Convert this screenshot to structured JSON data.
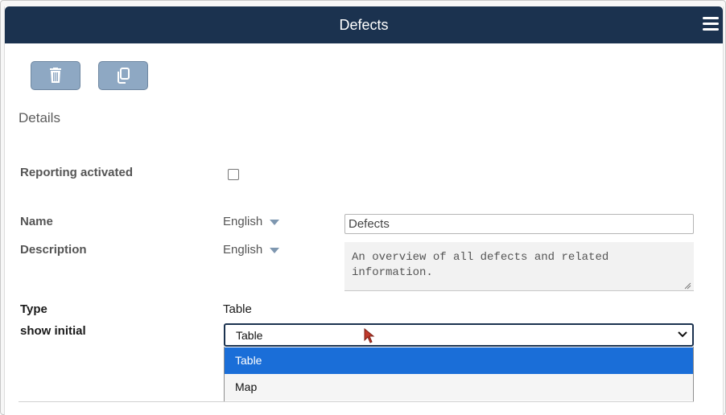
{
  "header": {
    "title": "Defects"
  },
  "toolbar": {
    "delete_icon": "trash-icon",
    "copy_icon": "copy-icon"
  },
  "section": {
    "title": "Details"
  },
  "fields": {
    "reporting_label": "Reporting activated",
    "reporting_checked": false,
    "name_label": "Name",
    "name_language": "English",
    "name_value": "Defects",
    "description_label": "Description",
    "description_language": "English",
    "description_value": "An overview of all defects and related information.",
    "type_label": "Type",
    "type_value": "Table",
    "show_initial_label": "show initial",
    "show_initial_selected": "Table",
    "show_initial_options": [
      "Table",
      "Map"
    ]
  },
  "colors": {
    "header_bg": "#1b324f",
    "button_bg": "#8ea8c3",
    "highlight": "#1a6ed8"
  }
}
